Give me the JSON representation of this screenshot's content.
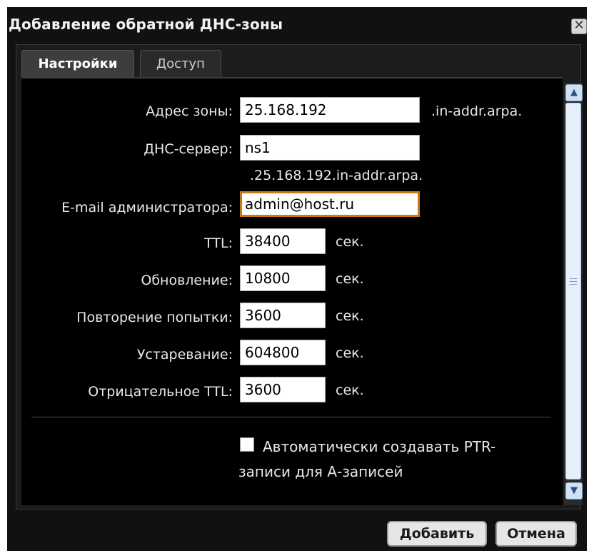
{
  "dialog": {
    "title": "Добавление обратной ДНС-зоны",
    "close_label": "✕"
  },
  "tabs": [
    {
      "label": "Настройки",
      "active": true
    },
    {
      "label": "Доступ",
      "active": false
    }
  ],
  "form": {
    "zone_address": {
      "label": "Адрес зоны:",
      "value": "25.168.192",
      "suffix": ".in-addr.arpa."
    },
    "dns_server": {
      "label": "ДНС-сервер:",
      "value": "ns1",
      "suffix": ".25.168.192.in-addr.arpa."
    },
    "admin_email": {
      "label": "E-mail администратора:",
      "value": "admin@host.ru"
    },
    "ttl": {
      "label": "TTL:",
      "value": "38400",
      "unit": "сек."
    },
    "refresh": {
      "label": "Обновление:",
      "value": "10800",
      "unit": "сек."
    },
    "retry": {
      "label": "Повторение попытки:",
      "value": "3600",
      "unit": "сек."
    },
    "expire": {
      "label": "Устаревание:",
      "value": "604800",
      "unit": "сек."
    },
    "negative_ttl": {
      "label": "Отрицательное TTL:",
      "value": "3600",
      "unit": "сек."
    },
    "auto_ptr": {
      "label": "Автоматически создавать PTR-записи для А-записей",
      "checked": false
    }
  },
  "buttons": {
    "add": "Добавить",
    "cancel": "Отмена"
  },
  "colors": {
    "background": "#111111",
    "content": "#000000",
    "focus_border": "#c87a17",
    "scrollbar": "#cfe1f5"
  }
}
